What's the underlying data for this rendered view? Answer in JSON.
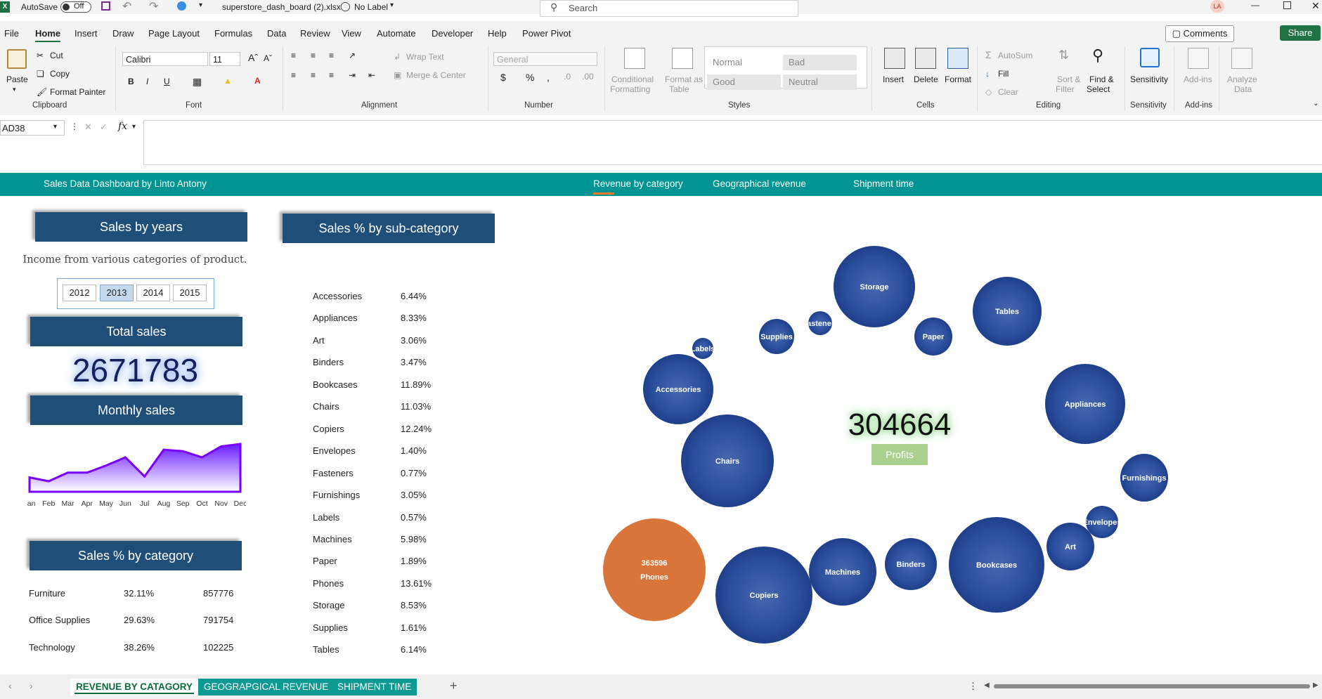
{
  "titlebar": {
    "autosave_label": "AutoSave",
    "autosave_state": "Off",
    "filename": "superstore_dash_board (2).xlsx",
    "sensitivity_label": "No Label",
    "search_placeholder": "Search",
    "user_initials": "LA"
  },
  "menu": {
    "items": [
      "File",
      "Home",
      "Insert",
      "Draw",
      "Page Layout",
      "Formulas",
      "Data",
      "Review",
      "View",
      "Automate",
      "Developer",
      "Help",
      "Power Pivot"
    ],
    "comments_label": "Comments",
    "share_label": "Share"
  },
  "ribbon": {
    "clipboard": {
      "paste": "Paste",
      "cut": "Cut",
      "copy": "Copy",
      "format_painter": "Format Painter",
      "group": "Clipboard"
    },
    "font": {
      "name": "Calibri",
      "size": "11",
      "group": "Font"
    },
    "alignment": {
      "wrap_text": "Wrap Text",
      "merge_center": "Merge & Center",
      "group": "Alignment"
    },
    "number": {
      "format": "General",
      "group": "Number"
    },
    "styles": {
      "conditional": "Conditional",
      "formatting": "Formatting",
      "format_as": "Format as",
      "table": "Table",
      "normal": "Normal",
      "bad": "Bad",
      "good": "Good",
      "neutral": "Neutral",
      "group": "Styles"
    },
    "cells": {
      "insert": "Insert",
      "delete": "Delete",
      "format": "Format",
      "group": "Cells"
    },
    "editing": {
      "autosum": "AutoSum",
      "fill": "Fill",
      "clear": "Clear",
      "sort": "Sort &",
      "filter": "Filter",
      "find": "Find &",
      "select": "Select",
      "group": "Editing"
    },
    "sensitivity": {
      "label": "Sensitivity",
      "group": "Sensitivity"
    },
    "addins": {
      "label": "Add-ins",
      "group": "Add-ins"
    },
    "analyze": {
      "label1": "Analyze",
      "label2": "Data"
    }
  },
  "formula_bar": {
    "cell_ref": "AD38",
    "fx": "fx"
  },
  "dashboard": {
    "title": "Sales Data Dashboard by Linto Antony",
    "nav": [
      "Revenue by category",
      "Geographical revenue",
      "Shipment time"
    ],
    "sales_by_years": {
      "header": "Sales by years",
      "subtitle": "Income from various categories of product.",
      "years": [
        "2012",
        "2013",
        "2014",
        "2015"
      ],
      "selected": "2013"
    },
    "total_sales": {
      "header": "Total sales",
      "value": "2671783"
    },
    "monthly_sales": {
      "header": "Monthly sales",
      "months": [
        "Jan",
        "Feb",
        "Mar",
        "Apr",
        "May",
        "Jun",
        "Jul",
        "Aug",
        "Sep",
        "Oct",
        "Nov",
        "Dec"
      ],
      "values": [
        0.3,
        0.22,
        0.4,
        0.4,
        0.55,
        0.72,
        0.32,
        0.88,
        0.85,
        0.72,
        0.95,
        1.0
      ],
      "color": "#7a00ff"
    },
    "sales_by_category": {
      "header": "Sales % by category",
      "rows": [
        {
          "name": "Furniture",
          "pct": "32.11%",
          "value": "857776"
        },
        {
          "name": "Office Supplies",
          "pct": "29.63%",
          "value": "791754"
        },
        {
          "name": "Technology",
          "pct": "38.26%",
          "value": "102225"
        }
      ]
    },
    "sales_by_subcategory": {
      "header": "Sales % by sub-category",
      "rows": [
        {
          "name": "Accessories",
          "pct": "6.44%"
        },
        {
          "name": "Appliances",
          "pct": "8.33%"
        },
        {
          "name": "Art",
          "pct": "3.06%"
        },
        {
          "name": "Binders",
          "pct": "3.47%"
        },
        {
          "name": "Bookcases",
          "pct": "11.89%"
        },
        {
          "name": "Chairs",
          "pct": "11.03%"
        },
        {
          "name": "Copiers",
          "pct": "12.24%"
        },
        {
          "name": "Envelopes",
          "pct": "1.40%"
        },
        {
          "name": "Fasteners",
          "pct": "0.77%"
        },
        {
          "name": "Furnishings",
          "pct": "3.05%"
        },
        {
          "name": "Labels",
          "pct": "0.57%"
        },
        {
          "name": "Machines",
          "pct": "5.98%"
        },
        {
          "name": "Paper",
          "pct": "1.89%"
        },
        {
          "name": "Phones",
          "pct": "13.61%"
        },
        {
          "name": "Storage",
          "pct": "8.53%"
        },
        {
          "name": "Supplies",
          "pct": "1.61%"
        },
        {
          "name": "Tables",
          "pct": "6.14%"
        }
      ]
    },
    "profits": {
      "value": "304664",
      "label": "Profits"
    },
    "bubbles": {
      "colors": {
        "default": "#2e4f99",
        "highlight": "#d9743b"
      },
      "items": [
        {
          "name": "Storage"
        },
        {
          "name": "Tables"
        },
        {
          "name": "Supplies"
        },
        {
          "name": "Fasteners",
          "shown": "astenei"
        },
        {
          "name": "Paper"
        },
        {
          "name": "Labels"
        },
        {
          "name": "Accessories"
        },
        {
          "name": "Appliances"
        },
        {
          "name": "Chairs"
        },
        {
          "name": "Furnishings"
        },
        {
          "name": "Envelopes"
        },
        {
          "name": "Art"
        },
        {
          "name": "Phones",
          "value": "363596",
          "highlight": true
        },
        {
          "name": "Copiers"
        },
        {
          "name": "Machines"
        },
        {
          "name": "Binders"
        },
        {
          "name": "Bookcases"
        }
      ]
    }
  },
  "sheets": {
    "tabs": [
      "REVENUE BY CATAGORY",
      "GEOGRAPGICAL REVENUE",
      "SHIPMENT TIME"
    ],
    "active": "REVENUE BY CATAGORY",
    "add_label": "+"
  }
}
